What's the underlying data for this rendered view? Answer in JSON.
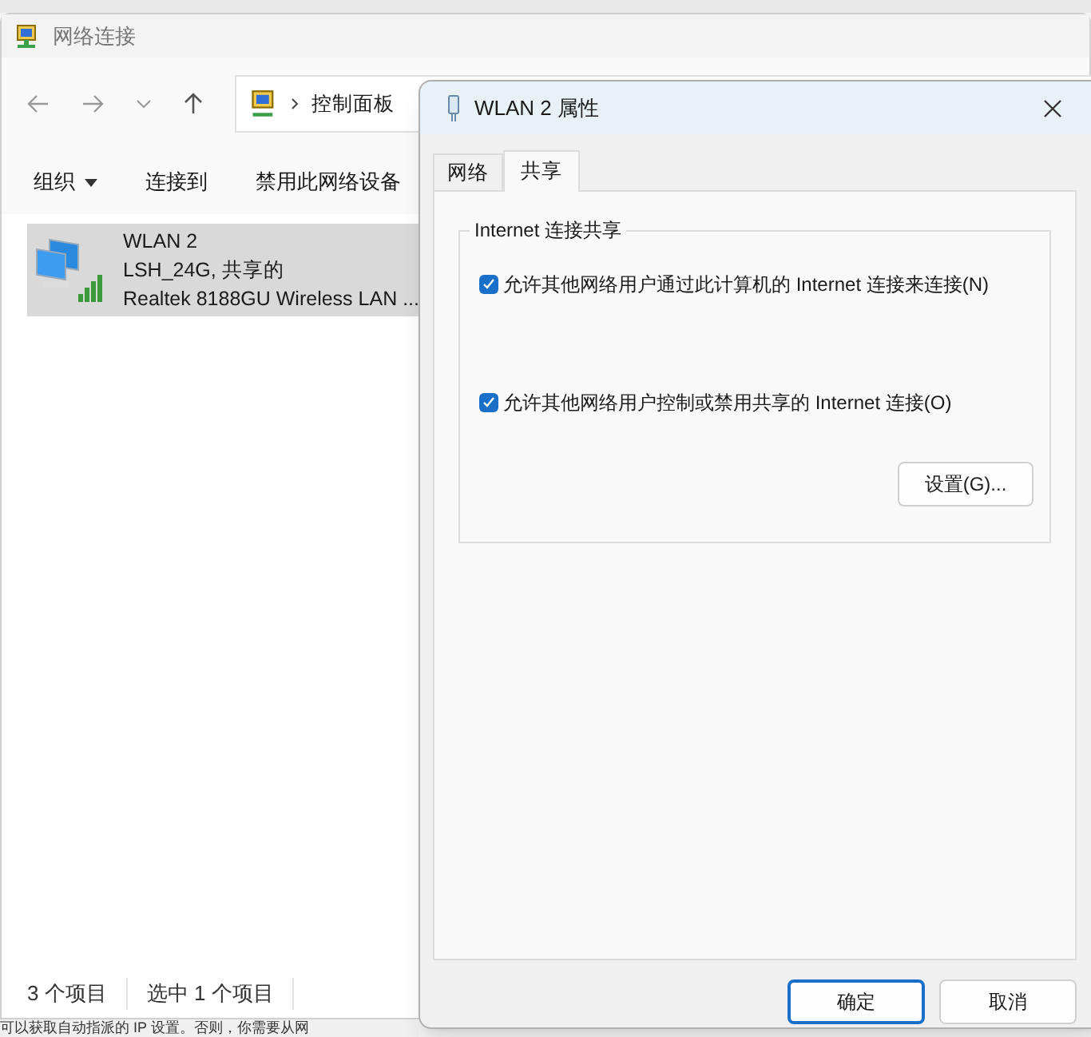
{
  "explorer": {
    "title": "网络连接",
    "breadcrumb": [
      "控制面板"
    ],
    "toolbar": [
      {
        "label": "组织",
        "dropdown": true
      },
      {
        "label": "连接到",
        "dropdown": false
      },
      {
        "label": "禁用此网络设备",
        "dropdown": false
      }
    ],
    "items": [
      {
        "name": "WLAN 2",
        "status": "LSH_24G, 共享的",
        "device": "Realtek 8188GU Wireless LAN ...",
        "selected": true
      }
    ],
    "status_bar": [
      "3 个项目",
      "选中 1 个项目"
    ]
  },
  "background_text": "可以获取自动指派的 IP 设置。否则，你需要从网",
  "dialog": {
    "title": "WLAN 2 属性",
    "tabs": [
      {
        "label": "网络",
        "selected": false
      },
      {
        "label": "共享",
        "selected": true
      }
    ],
    "group": {
      "title": "Internet 连接共享",
      "options": [
        {
          "label": "允许其他网络用户通过此计算机的 Internet 连接来连接(N)",
          "checked": true
        },
        {
          "label": "允许其他网络用户控制或禁用共享的 Internet 连接(O)",
          "checked": true
        }
      ],
      "settings_button": "设置(G)..."
    },
    "buttons": [
      {
        "label": "确定",
        "default": true
      },
      {
        "label": "取消",
        "default": false
      }
    ]
  }
}
